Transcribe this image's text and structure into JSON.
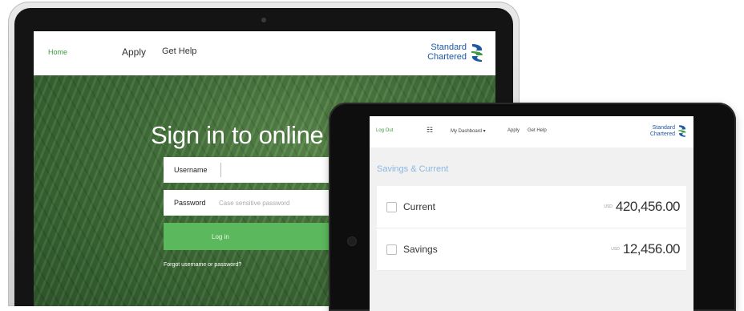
{
  "laptop": {
    "nav": {
      "home": "Home",
      "apply": "Apply",
      "help": "Get Help"
    },
    "logo": {
      "line1": "Standard",
      "line2": "Chartered"
    },
    "heading": "Sign in to online ba",
    "username_label": "Username",
    "password_label": "Password",
    "password_placeholder": "Case sensitive password",
    "login_label": "Log in",
    "forgot": "Forgot username or password?"
  },
  "tablet": {
    "nav": {
      "lang": "Log Out",
      "grid": "☷",
      "dashboard": "My Dashboard ▾",
      "apply": "Apply",
      "help": "Get Help"
    },
    "logo": {
      "line1": "Standard",
      "line2": "Chartered"
    },
    "section_title": "Savings & Current",
    "accounts": [
      {
        "name": "Current",
        "currency": "USD",
        "amount": "420,456.00"
      },
      {
        "name": "Savings",
        "currency": "USD",
        "amount": "12,456.00"
      }
    ]
  },
  "colors": {
    "brand_blue": "#1d58a6",
    "brand_green": "#3d9a3d",
    "login_green": "#5cb85c"
  }
}
